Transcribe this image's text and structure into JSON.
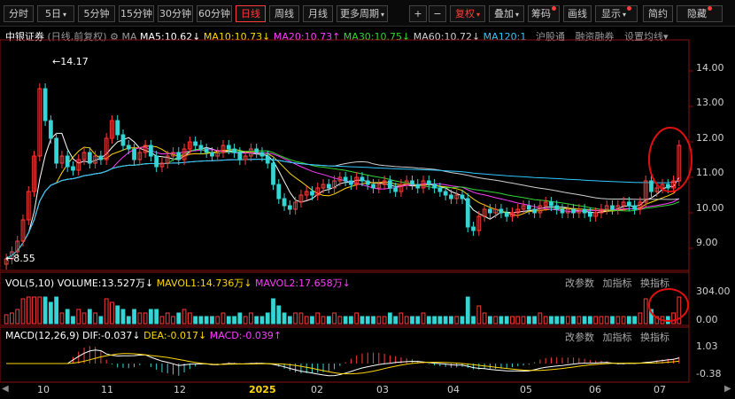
{
  "toolbar": {
    "periods": [
      "分时",
      "5日",
      "5分钟",
      "15分钟",
      "30分钟",
      "60分钟",
      "日线",
      "周线",
      "月线",
      "更多周期"
    ],
    "active_period": "日线",
    "tools": [
      "+",
      "−",
      "复权",
      "叠加",
      "筹码",
      "画线",
      "显示",
      "简约",
      "隐藏"
    ]
  },
  "main_header": {
    "stock_name": "中银证券",
    "mode": "(日线,前复权)",
    "ma_label": "MA",
    "ma5": "MA5:10.62",
    "ma10": "MA10:10.73",
    "ma20": "MA20:10.73",
    "ma30": "MA30:10.75",
    "ma60": "MA60:10.72",
    "ma120": "MA120:1",
    "links": [
      "沪股通",
      "融资融券",
      "设置均线"
    ]
  },
  "volume_header": {
    "name": "VOL(5,10)",
    "volume": "VOLUME:13.527万",
    "mavol1": "MAVOL1:14.736万",
    "mavol2": "MAVOL2:17.658万",
    "controls": [
      "改参数",
      "加指标",
      "换指标"
    ]
  },
  "macd_header": {
    "name": "MACD(12,26,9)",
    "dif": "DIF:-0.037",
    "dea": "DEA:-0.017",
    "macd": "MACD:-0.039",
    "controls": [
      "改参数",
      "加指标",
      "换指标"
    ]
  },
  "price_axis": [
    "14.00",
    "13.00",
    "12.00",
    "11.00",
    "10.00",
    "9.00"
  ],
  "volume_axis": [
    "304.00",
    "0.00"
  ],
  "macd_axis": [
    "1.03",
    "-0.38"
  ],
  "high_label": "14.17",
  "low_label": "8.55",
  "month_labels": [
    "10",
    "11",
    "12",
    "2025",
    "02",
    "03",
    "04",
    "05",
    "06",
    "07"
  ],
  "colors": {
    "up": "#ff3b3b",
    "down": "#35d5d5",
    "highlight": "#e01010"
  },
  "chart_data": {
    "type": "candlestick",
    "x": [
      "10",
      "11",
      "12",
      "2025",
      "02",
      "03",
      "04",
      "05",
      "06",
      "07"
    ],
    "ylim": [
      8.5,
      14.8
    ],
    "high": 14.17,
    "low": 8.55,
    "closes": [
      8.7,
      8.9,
      9.2,
      9.8,
      10.6,
      11.6,
      13.5,
      12.6,
      12.1,
      11.4,
      11.6,
      11.3,
      11.2,
      11.5,
      11.7,
      11.4,
      11.6,
      11.5,
      12.1,
      12.6,
      12.2,
      11.9,
      11.8,
      11.5,
      11.7,
      11.9,
      11.6,
      11.3,
      11.4,
      11.6,
      11.7,
      11.5,
      11.8,
      12.0,
      11.9,
      11.8,
      11.7,
      11.6,
      11.7,
      11.9,
      11.8,
      11.7,
      11.5,
      11.6,
      11.8,
      11.7,
      11.6,
      11.4,
      10.8,
      10.4,
      10.2,
      10.1,
      10.3,
      10.5,
      10.6,
      10.5,
      10.7,
      10.8,
      10.7,
      10.9,
      11.0,
      10.9,
      10.8,
      11.0,
      10.9,
      10.8,
      10.7,
      10.8,
      10.9,
      10.7,
      10.6,
      10.8,
      10.9,
      10.8,
      10.7,
      10.9,
      10.8,
      10.7,
      10.6,
      10.5,
      10.4,
      10.5,
      10.4,
      9.6,
      9.5,
      9.9,
      10.1,
      10.0,
      10.1,
      10.0,
      9.9,
      10.0,
      10.1,
      10.2,
      10.1,
      10.0,
      10.2,
      10.3,
      10.2,
      10.1,
      10.0,
      10.1,
      10.0,
      10.1,
      10.0,
      9.9,
      10.0,
      10.1,
      10.2,
      10.1,
      10.2,
      10.3,
      10.2,
      10.1,
      10.3,
      10.9,
      10.6,
      10.7,
      10.8,
      10.7,
      10.9,
      11.9
    ]
  }
}
